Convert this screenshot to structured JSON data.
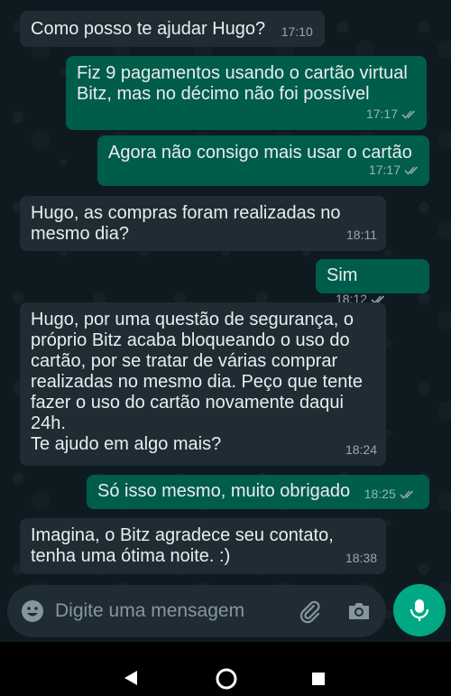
{
  "messages": [
    {
      "text": "Como posso te ajudar Hugo?",
      "time": "17:10"
    },
    {
      "text": "Fiz 9 pagamentos usando o cartão virtual\nBitz, mas no décimo não foi possível",
      "time": "17:17"
    },
    {
      "text": "Agora não consigo mais usar o cartão",
      "time": "17:17"
    },
    {
      "text": "Hugo, as compras foram realizadas no\nmesmo dia?",
      "time": "18:11"
    },
    {
      "text": "Sim",
      "time": "18:12"
    },
    {
      "text": "Hugo, por uma questão de segurança, o\npróprio Bitz acaba bloqueando o uso do\ncartão, por se tratar de várias comprar\nrealizadas no mesmo dia. Peço que tente\nfazer o uso do cartão novamente daqui\n24h.\nTe ajudo em algo mais?",
      "time": "18:24"
    },
    {
      "text": "Só isso mesmo, muito obrigado",
      "time": "18:25"
    },
    {
      "text": "Imagina, o Bitz agradece seu contato,\ntenha uma ótima noite. :)",
      "time": "18:38"
    }
  ],
  "composer": {
    "placeholder": "Digite uma mensagem"
  },
  "icons": {
    "emoji": "emoji-icon",
    "attach": "paperclip-icon",
    "camera": "camera-icon",
    "mic": "microphone-icon",
    "read_receipt": "double-check-icon"
  },
  "colors": {
    "incoming_bubble": "#1f2c33",
    "outgoing_bubble": "#005c4b",
    "accent": "#00a884"
  }
}
